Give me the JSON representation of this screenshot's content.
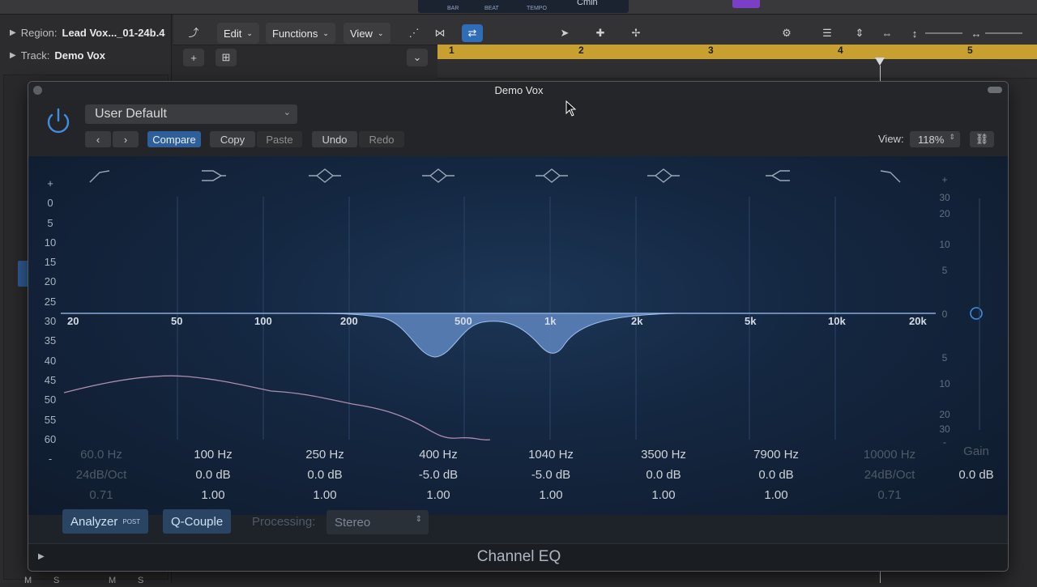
{
  "lcd": {
    "bar": "BAR",
    "beat": "BEAT",
    "tempo": "TEMPO",
    "key": "Cmin"
  },
  "inspector": {
    "region_label": "Region:",
    "region_value": "Lead Vox..._01-24b.4",
    "track_label": "Track:",
    "track_value": "Demo Vox"
  },
  "track_menu": {
    "edit": "Edit",
    "functions": "Functions",
    "view": "View"
  },
  "ruler": {
    "bars": [
      "1",
      "2",
      "3",
      "4",
      "5"
    ]
  },
  "eq": {
    "window_title": "Demo Vox",
    "preset": "User Default",
    "compare": "Compare",
    "copy": "Copy",
    "paste": "Paste",
    "undo": "Undo",
    "redo": "Redo",
    "view_label": "View:",
    "view_value": "118%",
    "left_scale": [
      "+",
      "0",
      "5",
      "10",
      "15",
      "20",
      "25",
      "30",
      "35",
      "40",
      "45",
      "50",
      "55",
      "60",
      "-"
    ],
    "right_scale": [
      "+",
      "30",
      "20",
      "10",
      "5",
      "0",
      "5",
      "10",
      "20",
      "30",
      "-"
    ],
    "freq_labels": [
      "20",
      "50",
      "100",
      "200",
      "500",
      "1k",
      "2k",
      "5k",
      "10k",
      "20k"
    ],
    "bands": [
      {
        "freq": "60.0 Hz",
        "gain": "24dB/Oct",
        "q": "0.71",
        "active": false,
        "shape": "highpass"
      },
      {
        "freq": "100 Hz",
        "gain": "0.0 dB",
        "q": "1.00",
        "active": true,
        "shape": "lowshelf"
      },
      {
        "freq": "250 Hz",
        "gain": "0.0 dB",
        "q": "1.00",
        "active": true,
        "shape": "bell"
      },
      {
        "freq": "400 Hz",
        "gain": "-5.0 dB",
        "q": "1.00",
        "active": true,
        "shape": "bell"
      },
      {
        "freq": "1040 Hz",
        "gain": "-5.0 dB",
        "q": "1.00",
        "active": true,
        "shape": "bell"
      },
      {
        "freq": "3500 Hz",
        "gain": "0.0 dB",
        "q": "1.00",
        "active": true,
        "shape": "bell"
      },
      {
        "freq": "7900 Hz",
        "gain": "0.0 dB",
        "q": "1.00",
        "active": true,
        "shape": "highshelf"
      },
      {
        "freq": "10000 Hz",
        "gain": "24dB/Oct",
        "q": "0.71",
        "active": false,
        "shape": "lowpass"
      }
    ],
    "gain_label": "Gain",
    "gain_value": "0.0 dB",
    "analyzer": "Analyzer",
    "analyzer_badge": "POST",
    "qcouple": "Q-Couple",
    "processing_label": "Processing:",
    "processing_value": "Stereo",
    "plugin_name": "Channel EQ"
  },
  "mixer_buttons": [
    "M",
    "S",
    "M",
    "S"
  ]
}
